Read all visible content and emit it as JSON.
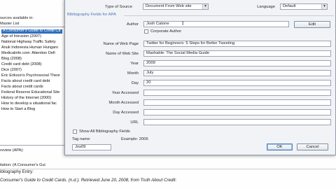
{
  "background": {
    "header_left": "ources available in:",
    "master_list_label": "Master List",
    "master_list": [
      "A Consumer's Guide to Credit Ca",
      "Age of Intrusion (2007)",
      "National Highway Traffic Safety",
      "Anuk Indonesia Human Hungaro",
      "Medicalinfo.com: Attention Defi",
      "Blog (2008)",
      "Credit card debt (2008)",
      "Dice (2007)",
      "Eric Erikson's Psychosocial Theor",
      "Facts about credit card debt",
      "Facts about credit cards",
      "Federal Reserve Educational Site",
      "History of the Internet (2000)",
      "How to develop a situational fac",
      "How to Start a Blog"
    ],
    "preview_label": "review (APA):",
    "citation_label": "itation: (A Consumer's Gui",
    "bibliography_label": "ibliography Entry:",
    "bibliography_entry": "Consumer's Guide to Credit Cards. (n.d.). Retrieved June 20, 2008, from Truth About Credit:"
  },
  "dialog": {
    "type_of_source_label": "Type of Source",
    "type_of_source_value": "Document From Web site",
    "language_label": "Language",
    "language_value": "Default",
    "fields_header": "Bibliography Fields for APA",
    "author_label": "Author",
    "author_value": "Josh Catone",
    "edit_button": "Edit",
    "corporate_author_label": "Corporate Author",
    "name_of_web_page_label": "Name of Web Page",
    "name_of_web_page_value": "Twitter for Beginners: 5 Steps for Better Tweeting",
    "name_of_web_site_label": "Name of Web Site",
    "name_of_web_site_value": "Mashable: The Social Media Guide",
    "year_label": "Year",
    "year_value": "2009",
    "month_label": "Month",
    "month_value": "July",
    "day_label": "Day",
    "day_value": "20",
    "year_accessed_label": "Year Accessed",
    "year_accessed_value": "",
    "month_accessed_label": "Month Accessed",
    "month_accessed_value": "",
    "day_accessed_label": "Day Accessed",
    "day_accessed_value": "",
    "url_label": "URL",
    "url_value": "",
    "show_all_label": "Show All Bibliography Fields",
    "tag_name_label": "Tag name",
    "tag_name_value": "Jos09",
    "example_label": "Example: 2006",
    "ok_button": "OK",
    "cancel_button": "Cancel"
  },
  "colors": {
    "selection": "#2f6fc0",
    "section_title": "#4a79b5",
    "dialog_bg": "#f1f3f6"
  }
}
